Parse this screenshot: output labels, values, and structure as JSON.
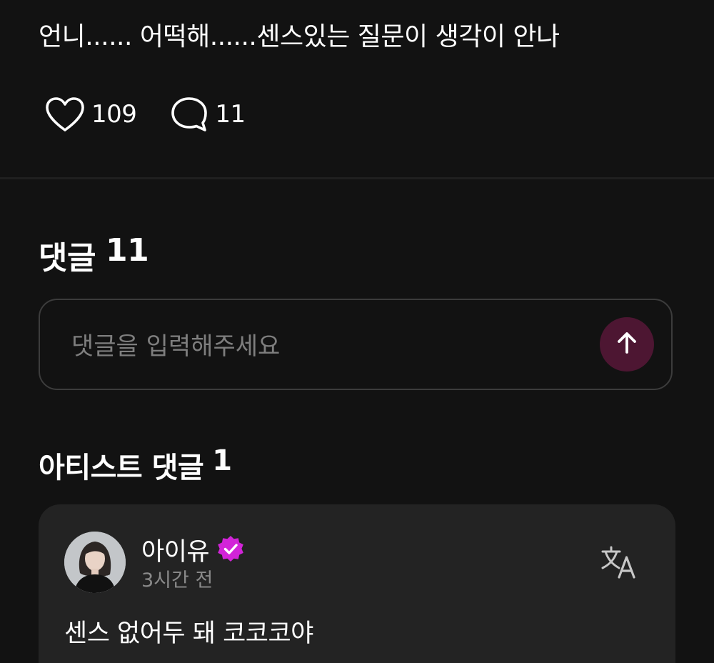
{
  "post": {
    "text": "언니...... 어떡해......센스있는 질문이 생각이 안나",
    "likes": "109",
    "comments": "11",
    "icons": {
      "like": "heart-outline-icon",
      "comment": "speech-bubble-icon"
    }
  },
  "comments_section": {
    "title": "댓글",
    "count": "11",
    "input_placeholder": "댓글을 입력해주세요",
    "send_icon": "arrow-up-icon"
  },
  "artist_comments": {
    "title": "아티스트 댓글",
    "count": "1",
    "items": [
      {
        "author": "아이유",
        "verified_icon": "verified-badge-icon",
        "time": "3시간 전",
        "text": "센스 없어두 돼 코코코야",
        "translate_icon": "translate-icon"
      }
    ]
  },
  "colors": {
    "background": "#121212",
    "card": "#232323",
    "accent_badge": "#d224d8",
    "send_button": "#4d1632",
    "muted_text": "#8a8a8a"
  }
}
